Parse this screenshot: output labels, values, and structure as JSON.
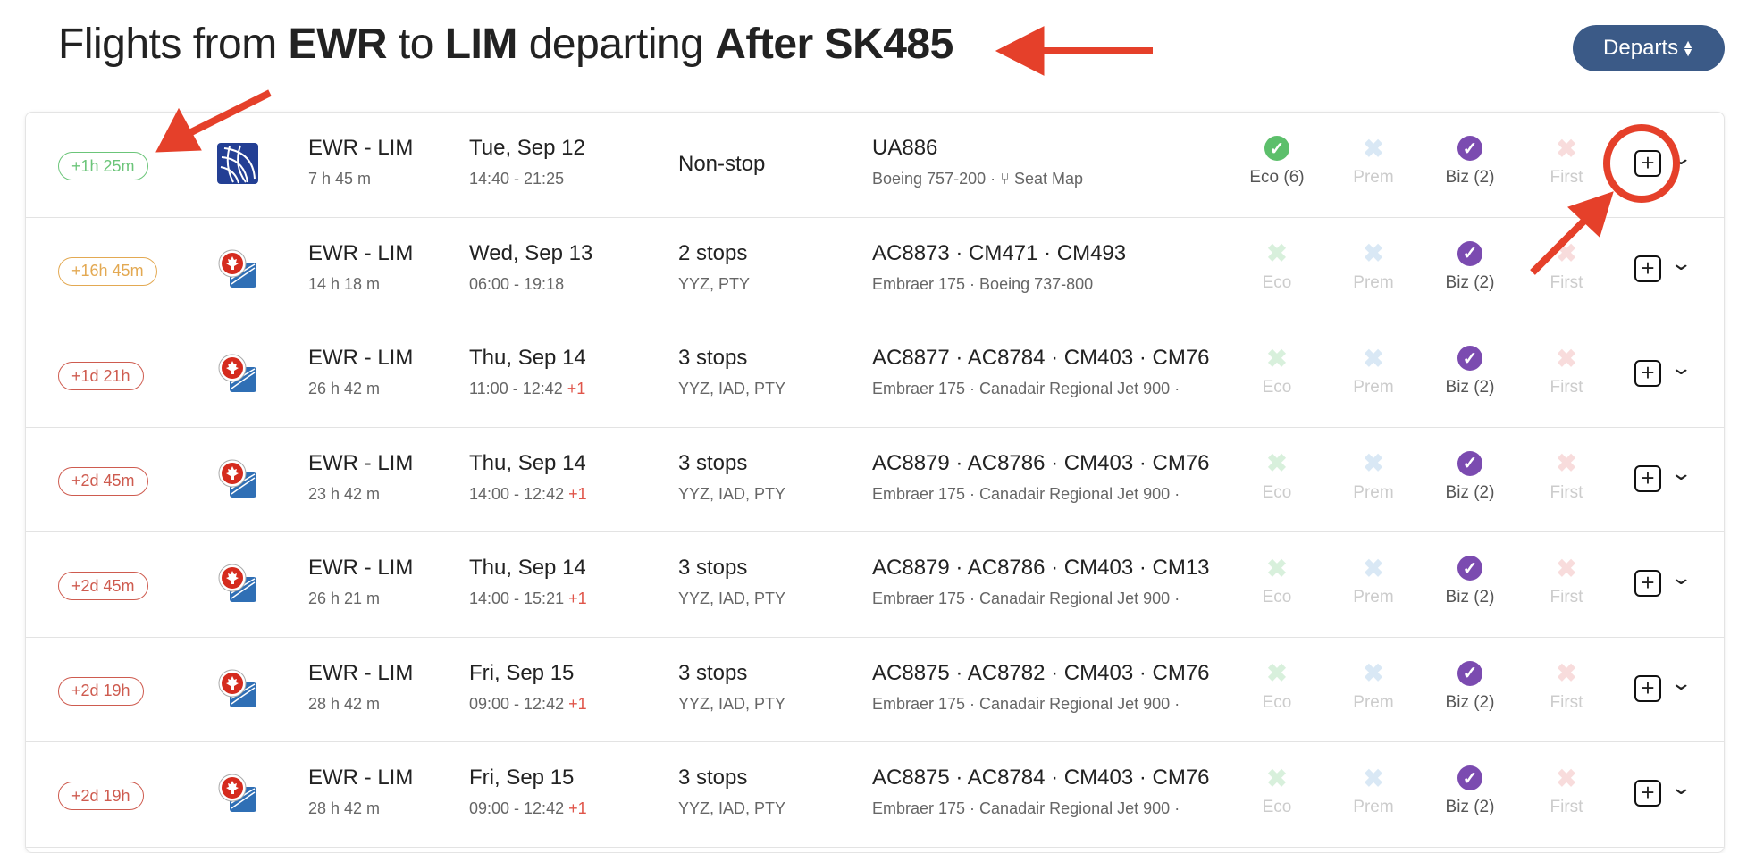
{
  "header": {
    "prefix": "Flights from ",
    "origin": "EWR",
    "mid1": " to ",
    "dest": "LIM",
    "mid2": " departing ",
    "after": "After SK485",
    "sort_label": "Departs",
    "sort_icon": "sort-arrows-icon"
  },
  "colors": {
    "green": "#5cbf6b",
    "orange": "#e0a040",
    "red": "#c94a3c",
    "purple": "#7b4bb0",
    "sort": "#3b5a87"
  },
  "rows": [
    {
      "badge": "+1h 25m",
      "badge_color": "green",
      "airline": "united",
      "route": "EWR - LIM",
      "duration": "7 h 45 m",
      "date": "Tue, Sep 12",
      "times": "14:40 - 21:25",
      "plus_day": "",
      "stops": "Non-stop",
      "via": "",
      "flights": "UA886",
      "aircraft": "Boeing 757-200  ·",
      "seat_map": "Seat Map",
      "eco": "Eco (6)",
      "eco_ok": true,
      "prem": "Prem",
      "biz": "Biz (2)",
      "first": "First"
    },
    {
      "badge": "+16h 45m",
      "badge_color": "orange",
      "airline": "aircanada",
      "route": "EWR - LIM",
      "duration": "14 h 18 m",
      "date": "Wed, Sep 13",
      "times": "06:00 - 19:18",
      "plus_day": "",
      "stops": "2 stops",
      "via": "YYZ, PTY",
      "flights": "AC8873 · CM471 · CM493",
      "aircraft": "Embraer 175  ·  Boeing 737-800",
      "eco": "Eco",
      "prem": "Prem",
      "biz": "Biz (2)",
      "first": "First"
    },
    {
      "badge": "+1d 21h",
      "badge_color": "red",
      "airline": "aircanada",
      "route": "EWR - LIM",
      "duration": "26 h 42 m",
      "date": "Thu, Sep 14",
      "times": "11:00 - 12:42 ",
      "plus_day": "+1",
      "stops": "3 stops",
      "via": "YYZ, IAD, PTY",
      "flights": "AC8877 · AC8784 · CM403 · CM76",
      "aircraft": "Embraer 175  ·  Canadair Regional Jet 900  ·",
      "eco": "Eco",
      "prem": "Prem",
      "biz": "Biz (2)",
      "first": "First"
    },
    {
      "badge": "+2d 45m",
      "badge_color": "red",
      "airline": "aircanada",
      "route": "EWR - LIM",
      "duration": "23 h 42 m",
      "date": "Thu, Sep 14",
      "times": "14:00 - 12:42 ",
      "plus_day": "+1",
      "stops": "3 stops",
      "via": "YYZ, IAD, PTY",
      "flights": "AC8879 · AC8786 · CM403 · CM76",
      "aircraft": "Embraer 175  ·  Canadair Regional Jet 900  ·",
      "eco": "Eco",
      "prem": "Prem",
      "biz": "Biz (2)",
      "first": "First"
    },
    {
      "badge": "+2d 45m",
      "badge_color": "red",
      "airline": "aircanada",
      "route": "EWR - LIM",
      "duration": "26 h 21 m",
      "date": "Thu, Sep 14",
      "times": "14:00 - 15:21 ",
      "plus_day": "+1",
      "stops": "3 stops",
      "via": "YYZ, IAD, PTY",
      "flights": "AC8879 · AC8786 · CM403 · CM13",
      "aircraft": "Embraer 175  ·  Canadair Regional Jet 900  ·",
      "eco": "Eco",
      "prem": "Prem",
      "biz": "Biz (2)",
      "first": "First"
    },
    {
      "badge": "+2d 19h",
      "badge_color": "red",
      "airline": "aircanada",
      "route": "EWR - LIM",
      "duration": "28 h 42 m",
      "date": "Fri, Sep 15",
      "times": "09:00 - 12:42 ",
      "plus_day": "+1",
      "stops": "3 stops",
      "via": "YYZ, IAD, PTY",
      "flights": "AC8875 · AC8782 · CM403 · CM76",
      "aircraft": "Embraer 175  ·  Canadair Regional Jet 900  ·",
      "eco": "Eco",
      "prem": "Prem",
      "biz": "Biz (2)",
      "first": "First"
    },
    {
      "badge": "+2d 19h",
      "badge_color": "red",
      "airline": "aircanada",
      "route": "EWR - LIM",
      "duration": "28 h 42 m",
      "date": "Fri, Sep 15",
      "times": "09:00 - 12:42 ",
      "plus_day": "+1",
      "stops": "3 stops",
      "via": "YYZ, IAD, PTY",
      "flights": "AC8875 · AC8784 · CM403 · CM76",
      "aircraft": "Embraer 175  ·  Canadair Regional Jet 900  ·",
      "eco": "Eco",
      "prem": "Prem",
      "biz": "Biz (2)",
      "first": "First"
    }
  ]
}
